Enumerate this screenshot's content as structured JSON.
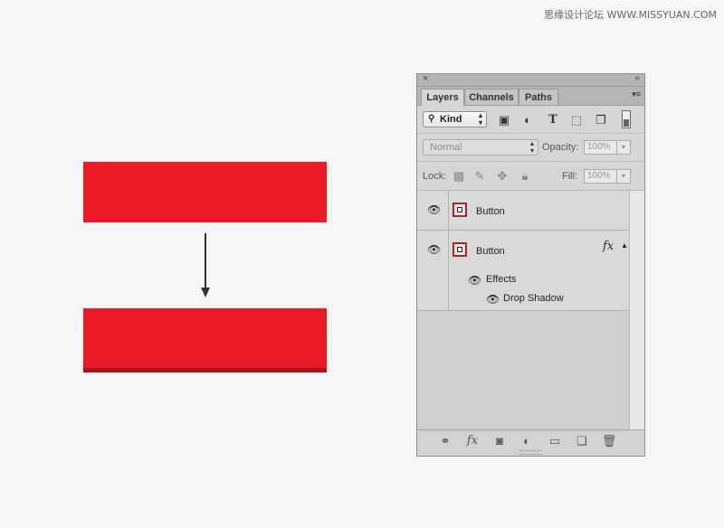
{
  "watermark": "思缘设计论坛 WWW.MISSYUAN.COM",
  "panel": {
    "close_glyph": "×",
    "collapse_glyph": "«",
    "menu_glyph": "▾≡",
    "tabs": [
      {
        "label": "Layers",
        "active": true
      },
      {
        "label": "Channels",
        "active": false
      },
      {
        "label": "Paths",
        "active": false
      }
    ],
    "filter": {
      "kind_label": "Kind",
      "icons": [
        "image-filter-icon",
        "adjustment-filter-icon",
        "type-filter-icon",
        "shape-filter-icon",
        "smart-object-filter-icon"
      ]
    },
    "blend": {
      "mode": "Normal",
      "opacity_label": "Opacity:",
      "opacity_value": "100%"
    },
    "lock": {
      "lock_label": "Lock:",
      "fill_label": "Fill:",
      "fill_value": "100%"
    },
    "layers": [
      {
        "name": "Button",
        "has_fx": false
      },
      {
        "name": "Button",
        "has_fx": true,
        "effects_label": "Effects",
        "effect": "Drop Shadow"
      }
    ],
    "fx_glyph": "fx"
  }
}
